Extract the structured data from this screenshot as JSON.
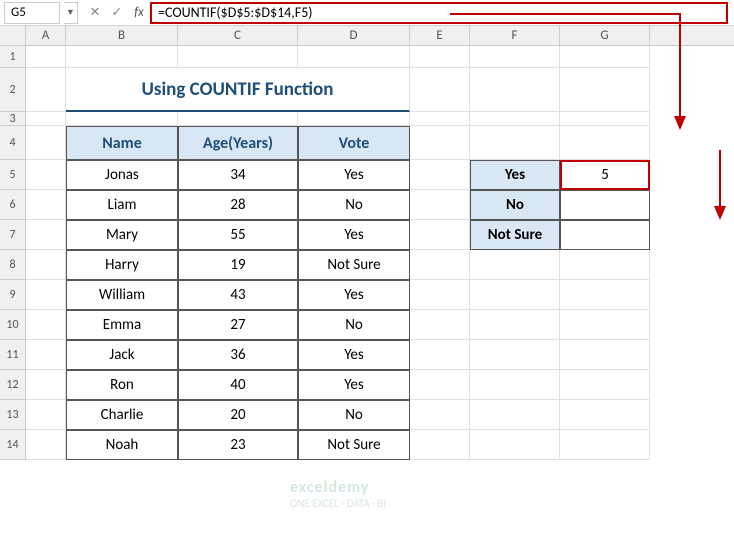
{
  "formula_bar": {
    "name_box": "G5",
    "formula": "=COUNTIF($D$5:$D$14,F5)"
  },
  "columns": [
    "A",
    "B",
    "C",
    "D",
    "E",
    "F",
    "G"
  ],
  "rows": [
    "1",
    "2",
    "3",
    "4",
    "5",
    "6",
    "7",
    "8",
    "9",
    "10",
    "11",
    "12",
    "13",
    "14"
  ],
  "title": "Using COUNTIF Function",
  "table": {
    "headers": {
      "name": "Name",
      "age": "Age(Years)",
      "vote": "Vote"
    },
    "rows": [
      {
        "name": "Jonas",
        "age": "34",
        "vote": "Yes"
      },
      {
        "name": "Liam",
        "age": "28",
        "vote": "No"
      },
      {
        "name": "Mary",
        "age": "55",
        "vote": "Yes"
      },
      {
        "name": "Harry",
        "age": "19",
        "vote": "Not Sure"
      },
      {
        "name": "William",
        "age": "43",
        "vote": "Yes"
      },
      {
        "name": "Emma",
        "age": "27",
        "vote": "No"
      },
      {
        "name": "Jack",
        "age": "36",
        "vote": "Yes"
      },
      {
        "name": "Ron",
        "age": "40",
        "vote": "Yes"
      },
      {
        "name": "Charlie",
        "age": "20",
        "vote": "No"
      },
      {
        "name": "Noah",
        "age": "23",
        "vote": "Not Sure"
      }
    ]
  },
  "summary": {
    "rows": [
      {
        "label": "Yes",
        "value": "5"
      },
      {
        "label": "No",
        "value": ""
      },
      {
        "label": "Not Sure",
        "value": ""
      }
    ]
  },
  "watermark": {
    "line1": "exceldemy",
    "line2": "ONE EXCEL · DATA · BI"
  },
  "chart_data": {
    "type": "table",
    "title": "Using COUNTIF Function",
    "columns": [
      "Name",
      "Age(Years)",
      "Vote"
    ],
    "rows": [
      [
        "Jonas",
        34,
        "Yes"
      ],
      [
        "Liam",
        28,
        "No"
      ],
      [
        "Mary",
        55,
        "Yes"
      ],
      [
        "Harry",
        19,
        "Not Sure"
      ],
      [
        "William",
        43,
        "Yes"
      ],
      [
        "Emma",
        27,
        "No"
      ],
      [
        "Jack",
        36,
        "Yes"
      ],
      [
        "Ron",
        40,
        "Yes"
      ],
      [
        "Charlie",
        20,
        "No"
      ],
      [
        "Noah",
        23,
        "Not Sure"
      ]
    ],
    "summary": [
      [
        "Yes",
        5
      ],
      [
        "No",
        null
      ],
      [
        "Not Sure",
        null
      ]
    ]
  }
}
